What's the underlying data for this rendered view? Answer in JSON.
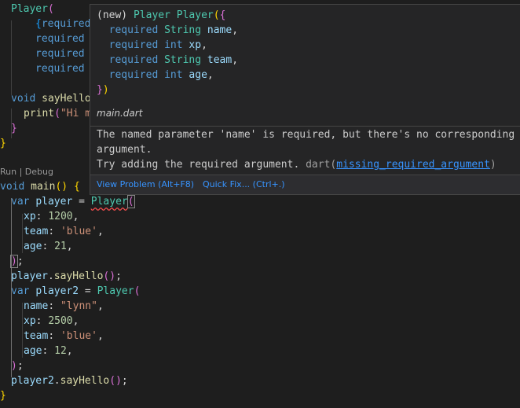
{
  "code": {
    "ctor_name": "Player",
    "ctor_open": "(",
    "required_kw": "required",
    "void_kw": "void",
    "say_hello_partial": "sayHello",
    "print_fn": "print",
    "print_str_partial": "\"Hi m",
    "main_fn": "main",
    "var_kw": "var",
    "player_var": "player",
    "player2_var": "player2",
    "player_class": "Player",
    "xp_label": "xp",
    "team_label": "team",
    "age_label": "age",
    "name_label": "name",
    "p1": {
      "xp": "1200",
      "team": "'blue'",
      "age": "21"
    },
    "p2": {
      "name": "\"lynn\"",
      "xp": "2500",
      "team": "'blue'",
      "age": "12"
    },
    "say_hello_call": "sayHello"
  },
  "codelens": {
    "run": "Run",
    "separator": " | ",
    "debug": "Debug"
  },
  "hover": {
    "signature": {
      "prefix": "(new) ",
      "class_name": "Player",
      "ctor_name": "Player",
      "params": [
        {
          "kw": "required",
          "type": "String",
          "name": "name"
        },
        {
          "kw": "required",
          "type": "int",
          "name": "xp"
        },
        {
          "kw": "required",
          "type": "String",
          "name": "team"
        },
        {
          "kw": "required",
          "type": "int",
          "name": "age"
        }
      ]
    },
    "file_name": "main.dart",
    "message_line1": "The named parameter 'name' is required, but there's no corresponding",
    "message_line2": "argument.",
    "message_line3": "Try adding the required argument.",
    "source": "dart",
    "code_link": "missing_required_argument",
    "view_problem": "View Problem (Alt+F8)",
    "quick_fix": "Quick Fix... (Ctrl+.)"
  }
}
